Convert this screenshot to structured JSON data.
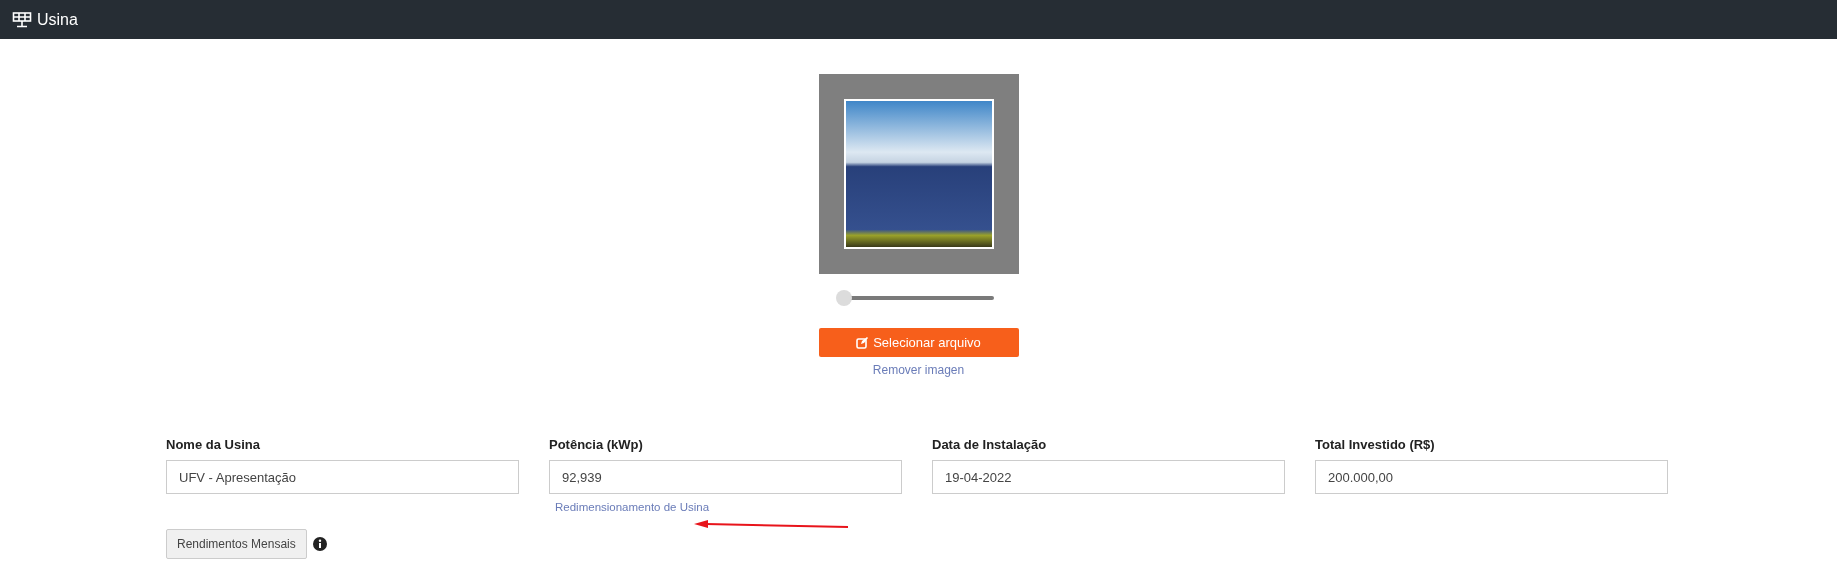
{
  "header": {
    "title": "Usina"
  },
  "image_editor": {
    "zoom": {
      "level": 0
    },
    "select_button": "Selecionar arquivo",
    "remove_link": "Remover imagen"
  },
  "fields": [
    {
      "label": "Nome da Usina",
      "value": "UFV - Apresentação"
    },
    {
      "label": "Potência (kWp)",
      "value": "92,939",
      "link": "Redimensionamento de Usina"
    },
    {
      "label": "Data de Instalação",
      "value": "19-04-2022"
    },
    {
      "label": "Total Investido (R$)",
      "value": "200.000,00"
    }
  ],
  "monthly_button": "Rendimentos Mensais"
}
